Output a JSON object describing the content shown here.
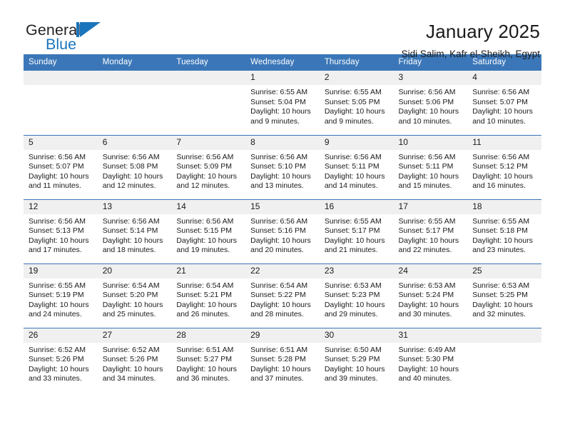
{
  "brand": {
    "name_part1": "General",
    "name_part2": "Blue",
    "triangle_icon": "triangle-icon",
    "accent_color": "#1b75bc"
  },
  "header": {
    "title": "January 2025",
    "location": "Sidi Salim, Kafr el-Sheikh, Egypt"
  },
  "theme": {
    "header_blue": "#3b77b8",
    "daynum_background": "#f0f0f0",
    "text_color": "#1a1a1a"
  },
  "calendar": {
    "weekday_headers": [
      "Sunday",
      "Monday",
      "Tuesday",
      "Wednesday",
      "Thursday",
      "Friday",
      "Saturday"
    ],
    "weeks": [
      [
        {
          "day": "",
          "empty": true
        },
        {
          "day": "",
          "empty": true
        },
        {
          "day": "",
          "empty": true
        },
        {
          "day": "1",
          "sunrise": "Sunrise: 6:55 AM",
          "sunset": "Sunset: 5:04 PM",
          "daylight_line1": "Daylight: 10 hours",
          "daylight_line2": "and 9 minutes."
        },
        {
          "day": "2",
          "sunrise": "Sunrise: 6:55 AM",
          "sunset": "Sunset: 5:05 PM",
          "daylight_line1": "Daylight: 10 hours",
          "daylight_line2": "and 9 minutes."
        },
        {
          "day": "3",
          "sunrise": "Sunrise: 6:56 AM",
          "sunset": "Sunset: 5:06 PM",
          "daylight_line1": "Daylight: 10 hours",
          "daylight_line2": "and 10 minutes."
        },
        {
          "day": "4",
          "sunrise": "Sunrise: 6:56 AM",
          "sunset": "Sunset: 5:07 PM",
          "daylight_line1": "Daylight: 10 hours",
          "daylight_line2": "and 10 minutes."
        }
      ],
      [
        {
          "day": "5",
          "sunrise": "Sunrise: 6:56 AM",
          "sunset": "Sunset: 5:07 PM",
          "daylight_line1": "Daylight: 10 hours",
          "daylight_line2": "and 11 minutes."
        },
        {
          "day": "6",
          "sunrise": "Sunrise: 6:56 AM",
          "sunset": "Sunset: 5:08 PM",
          "daylight_line1": "Daylight: 10 hours",
          "daylight_line2": "and 12 minutes."
        },
        {
          "day": "7",
          "sunrise": "Sunrise: 6:56 AM",
          "sunset": "Sunset: 5:09 PM",
          "daylight_line1": "Daylight: 10 hours",
          "daylight_line2": "and 12 minutes."
        },
        {
          "day": "8",
          "sunrise": "Sunrise: 6:56 AM",
          "sunset": "Sunset: 5:10 PM",
          "daylight_line1": "Daylight: 10 hours",
          "daylight_line2": "and 13 minutes."
        },
        {
          "day": "9",
          "sunrise": "Sunrise: 6:56 AM",
          "sunset": "Sunset: 5:11 PM",
          "daylight_line1": "Daylight: 10 hours",
          "daylight_line2": "and 14 minutes."
        },
        {
          "day": "10",
          "sunrise": "Sunrise: 6:56 AM",
          "sunset": "Sunset: 5:11 PM",
          "daylight_line1": "Daylight: 10 hours",
          "daylight_line2": "and 15 minutes."
        },
        {
          "day": "11",
          "sunrise": "Sunrise: 6:56 AM",
          "sunset": "Sunset: 5:12 PM",
          "daylight_line1": "Daylight: 10 hours",
          "daylight_line2": "and 16 minutes."
        }
      ],
      [
        {
          "day": "12",
          "sunrise": "Sunrise: 6:56 AM",
          "sunset": "Sunset: 5:13 PM",
          "daylight_line1": "Daylight: 10 hours",
          "daylight_line2": "and 17 minutes."
        },
        {
          "day": "13",
          "sunrise": "Sunrise: 6:56 AM",
          "sunset": "Sunset: 5:14 PM",
          "daylight_line1": "Daylight: 10 hours",
          "daylight_line2": "and 18 minutes."
        },
        {
          "day": "14",
          "sunrise": "Sunrise: 6:56 AM",
          "sunset": "Sunset: 5:15 PM",
          "daylight_line1": "Daylight: 10 hours",
          "daylight_line2": "and 19 minutes."
        },
        {
          "day": "15",
          "sunrise": "Sunrise: 6:56 AM",
          "sunset": "Sunset: 5:16 PM",
          "daylight_line1": "Daylight: 10 hours",
          "daylight_line2": "and 20 minutes."
        },
        {
          "day": "16",
          "sunrise": "Sunrise: 6:55 AM",
          "sunset": "Sunset: 5:17 PM",
          "daylight_line1": "Daylight: 10 hours",
          "daylight_line2": "and 21 minutes."
        },
        {
          "day": "17",
          "sunrise": "Sunrise: 6:55 AM",
          "sunset": "Sunset: 5:17 PM",
          "daylight_line1": "Daylight: 10 hours",
          "daylight_line2": "and 22 minutes."
        },
        {
          "day": "18",
          "sunrise": "Sunrise: 6:55 AM",
          "sunset": "Sunset: 5:18 PM",
          "daylight_line1": "Daylight: 10 hours",
          "daylight_line2": "and 23 minutes."
        }
      ],
      [
        {
          "day": "19",
          "sunrise": "Sunrise: 6:55 AM",
          "sunset": "Sunset: 5:19 PM",
          "daylight_line1": "Daylight: 10 hours",
          "daylight_line2": "and 24 minutes."
        },
        {
          "day": "20",
          "sunrise": "Sunrise: 6:54 AM",
          "sunset": "Sunset: 5:20 PM",
          "daylight_line1": "Daylight: 10 hours",
          "daylight_line2": "and 25 minutes."
        },
        {
          "day": "21",
          "sunrise": "Sunrise: 6:54 AM",
          "sunset": "Sunset: 5:21 PM",
          "daylight_line1": "Daylight: 10 hours",
          "daylight_line2": "and 26 minutes."
        },
        {
          "day": "22",
          "sunrise": "Sunrise: 6:54 AM",
          "sunset": "Sunset: 5:22 PM",
          "daylight_line1": "Daylight: 10 hours",
          "daylight_line2": "and 28 minutes."
        },
        {
          "day": "23",
          "sunrise": "Sunrise: 6:53 AM",
          "sunset": "Sunset: 5:23 PM",
          "daylight_line1": "Daylight: 10 hours",
          "daylight_line2": "and 29 minutes."
        },
        {
          "day": "24",
          "sunrise": "Sunrise: 6:53 AM",
          "sunset": "Sunset: 5:24 PM",
          "daylight_line1": "Daylight: 10 hours",
          "daylight_line2": "and 30 minutes."
        },
        {
          "day": "25",
          "sunrise": "Sunrise: 6:53 AM",
          "sunset": "Sunset: 5:25 PM",
          "daylight_line1": "Daylight: 10 hours",
          "daylight_line2": "and 32 minutes."
        }
      ],
      [
        {
          "day": "26",
          "sunrise": "Sunrise: 6:52 AM",
          "sunset": "Sunset: 5:26 PM",
          "daylight_line1": "Daylight: 10 hours",
          "daylight_line2": "and 33 minutes."
        },
        {
          "day": "27",
          "sunrise": "Sunrise: 6:52 AM",
          "sunset": "Sunset: 5:26 PM",
          "daylight_line1": "Daylight: 10 hours",
          "daylight_line2": "and 34 minutes."
        },
        {
          "day": "28",
          "sunrise": "Sunrise: 6:51 AM",
          "sunset": "Sunset: 5:27 PM",
          "daylight_line1": "Daylight: 10 hours",
          "daylight_line2": "and 36 minutes."
        },
        {
          "day": "29",
          "sunrise": "Sunrise: 6:51 AM",
          "sunset": "Sunset: 5:28 PM",
          "daylight_line1": "Daylight: 10 hours",
          "daylight_line2": "and 37 minutes."
        },
        {
          "day": "30",
          "sunrise": "Sunrise: 6:50 AM",
          "sunset": "Sunset: 5:29 PM",
          "daylight_line1": "Daylight: 10 hours",
          "daylight_line2": "and 39 minutes."
        },
        {
          "day": "31",
          "sunrise": "Sunrise: 6:49 AM",
          "sunset": "Sunset: 5:30 PM",
          "daylight_line1": "Daylight: 10 hours",
          "daylight_line2": "and 40 minutes."
        },
        {
          "day": "",
          "empty": true
        }
      ]
    ]
  }
}
